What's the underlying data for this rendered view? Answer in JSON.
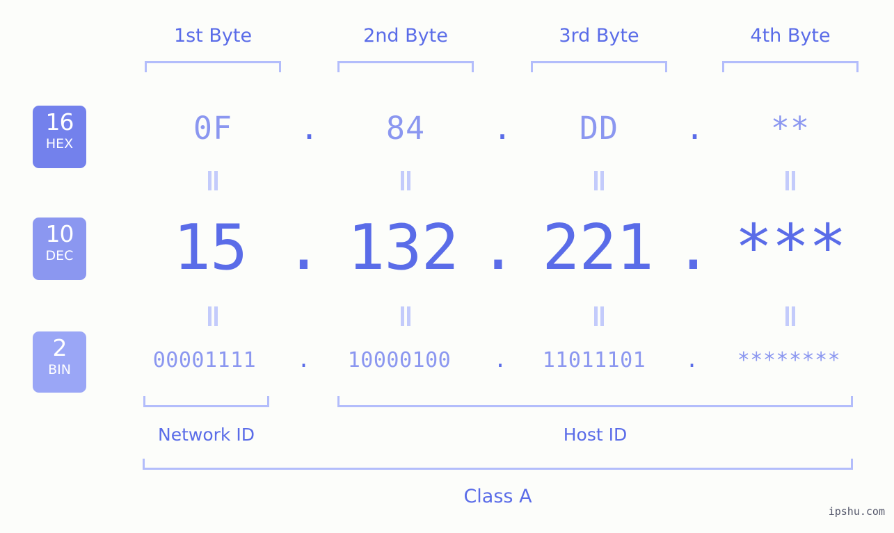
{
  "colors": {
    "background": "#fcfdfa",
    "accent_dark": "#5a6ce8",
    "accent_mid": "#8b97f0",
    "accent_light": "#b3bdfb",
    "badge_hex": "#7381ec",
    "badge_dec": "#8b97f0",
    "badge_bin": "#9aa6f6"
  },
  "byte_headers": [
    {
      "label": "1st Byte"
    },
    {
      "label": "2nd Byte"
    },
    {
      "label": "3rd Byte"
    },
    {
      "label": "4th Byte"
    }
  ],
  "bases": [
    {
      "number": "16",
      "name": "HEX"
    },
    {
      "number": "10",
      "name": "DEC"
    },
    {
      "number": "2",
      "name": "BIN"
    }
  ],
  "rows": {
    "hex": {
      "base_number": "16",
      "base_name": "HEX",
      "values": [
        "0F",
        "84",
        "DD",
        "**"
      ],
      "separators": [
        ".",
        ".",
        "."
      ]
    },
    "dec": {
      "base_number": "10",
      "base_name": "DEC",
      "values": [
        "15",
        "132",
        "221",
        "***"
      ],
      "separators": [
        ".",
        ".",
        "."
      ]
    },
    "bin": {
      "base_number": "2",
      "base_name": "BIN",
      "values": [
        "00001111",
        "10000100",
        "11011101",
        "********"
      ],
      "separators": [
        ".",
        ".",
        "."
      ]
    }
  },
  "equals_symbol": "=",
  "segments": {
    "network_id": "Network ID",
    "host_id": "Host ID",
    "class": "Class A"
  },
  "watermark": "ipshu.com"
}
